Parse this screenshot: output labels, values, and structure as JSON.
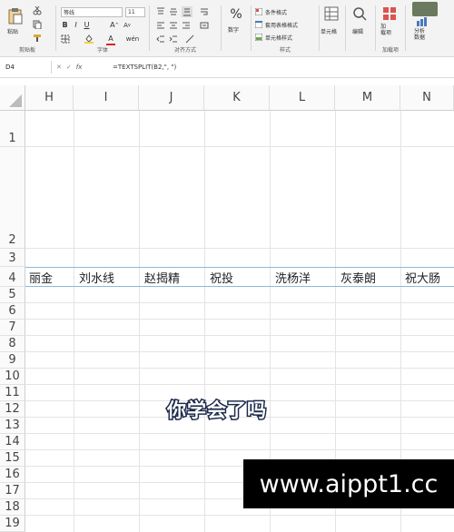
{
  "ribbon": {
    "clipboard": {
      "paste": "粘贴",
      "label": "剪贴板"
    },
    "font": {
      "name": "等线",
      "size": "11",
      "label": "字体"
    },
    "alignment": {
      "label": "对齐方式"
    },
    "number": {
      "format": "数字"
    },
    "styles": {
      "conditional": "条件格式",
      "table": "套用表格格式",
      "cell": "单元格样式",
      "label": "样式"
    },
    "cells": {
      "label": "单元格"
    },
    "editing": {
      "label": "编辑"
    },
    "addins": {
      "addin": "加\n载项",
      "label": "加载项"
    },
    "analysis": {
      "analyze": "分析\n数据"
    }
  },
  "formula_bar": {
    "name_box": "D4",
    "fx": "fx",
    "formula": "=TEXTSPLIT(B2,\", \")"
  },
  "columns": [
    "H",
    "I",
    "J",
    "K",
    "L",
    "M",
    "N"
  ],
  "rows": [
    "1",
    "2",
    "3",
    "4",
    "5",
    "6",
    "7",
    "8",
    "9",
    "10",
    "11",
    "12",
    "13",
    "14",
    "15",
    "16",
    "17",
    "18",
    "19"
  ],
  "row4_cells": [
    "丽金",
    "刘水线",
    "赵揭精",
    "祝投",
    "洗杨洋",
    "灰泰朗",
    "祝大肠"
  ],
  "caption": "你学会了吗",
  "watermark": "www.aippt1.cc"
}
